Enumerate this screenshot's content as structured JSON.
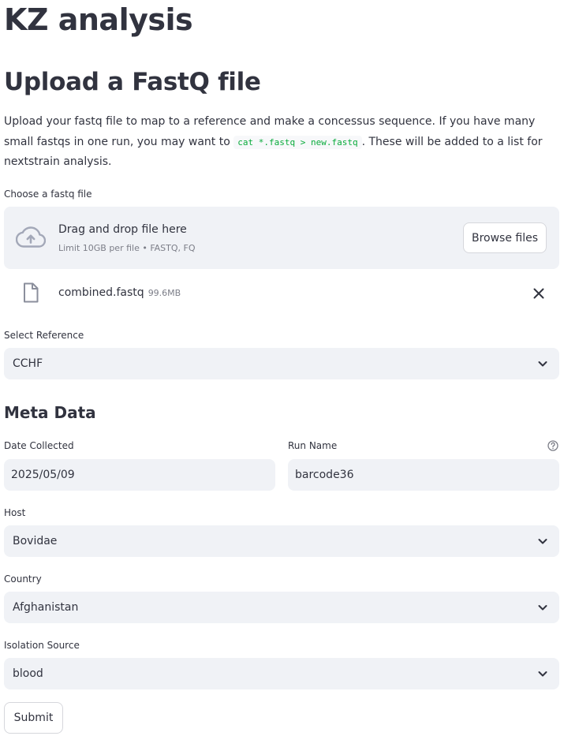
{
  "page": {
    "title": "KZ analysis",
    "section_title": "Upload a FastQ file",
    "intro_before_code": "Upload your fastq file to map to a reference and make a concessus sequence. If you have many small fastqs in one run, you may want to ",
    "intro_code": "cat *.fastq > new.fastq",
    "intro_after_code": ". These will be added to a list for nextstrain analysis."
  },
  "uploader": {
    "label": "Choose a fastq file",
    "drop_title": "Drag and drop file here",
    "drop_subtitle": "Limit 10GB per file • FASTQ, FQ",
    "browse_label": "Browse files",
    "cloud_icon": "cloud-upload-icon",
    "uploaded_file": {
      "name": "combined.fastq",
      "size": "99.6MB",
      "file_icon": "file-icon",
      "remove_icon": "close-icon"
    }
  },
  "reference": {
    "label": "Select Reference",
    "value": "CCHF"
  },
  "metadata": {
    "title": "Meta Data",
    "date_collected": {
      "label": "Date Collected",
      "value": "2025/05/09"
    },
    "run_name": {
      "label": "Run Name",
      "value": "barcode36",
      "help_icon": "help-circle-icon"
    },
    "host": {
      "label": "Host",
      "value": "Bovidae"
    },
    "country": {
      "label": "Country",
      "value": "Afghanistan"
    },
    "isolation_source": {
      "label": "Isolation Source",
      "value": "blood"
    }
  },
  "form": {
    "submit_label": "Submit"
  },
  "colors": {
    "text": "#31333f",
    "muted": "#7c7e88",
    "field_bg": "#f0f2f6",
    "code_green": "#09ab3b",
    "icon_gray": "#a3a8b8"
  }
}
